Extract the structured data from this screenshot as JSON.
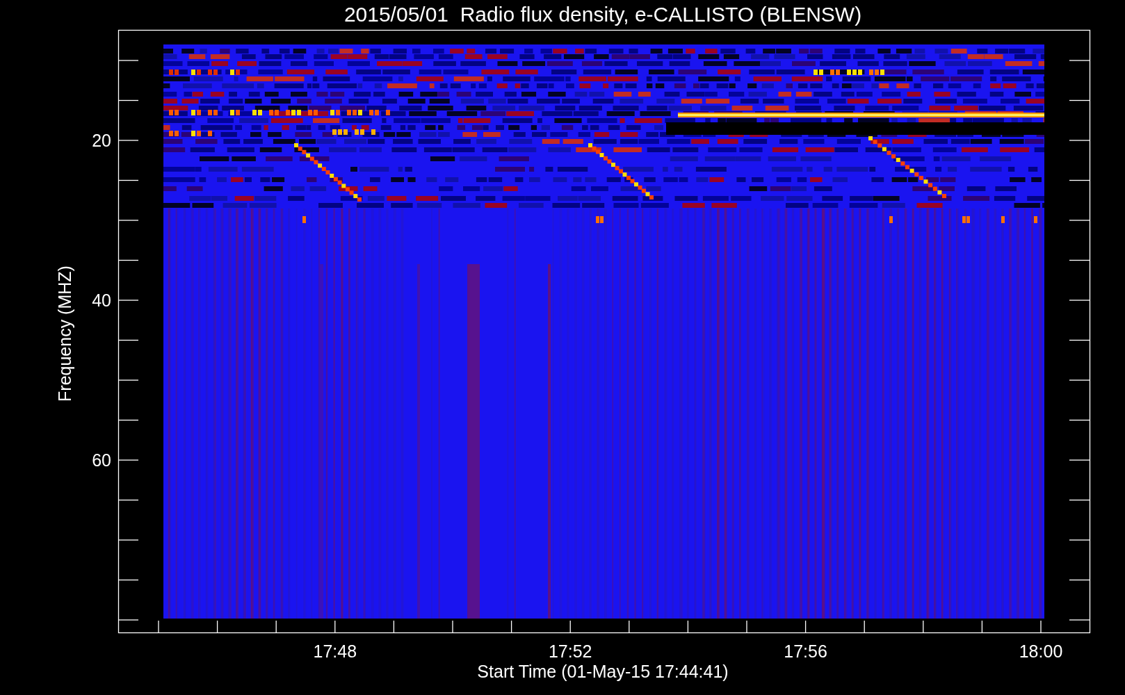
{
  "title": "2015/05/01  Radio flux density, e-CALLISTO (BLENSW)",
  "y_axis": {
    "label": "Frequency (MHZ)",
    "ticks": [
      "20",
      "40",
      "60"
    ]
  },
  "x_axis": {
    "label": "Start Time (01-May-15 17:44:41)",
    "ticks": [
      "17:48",
      "17:52",
      "17:56",
      "18:00"
    ]
  }
}
